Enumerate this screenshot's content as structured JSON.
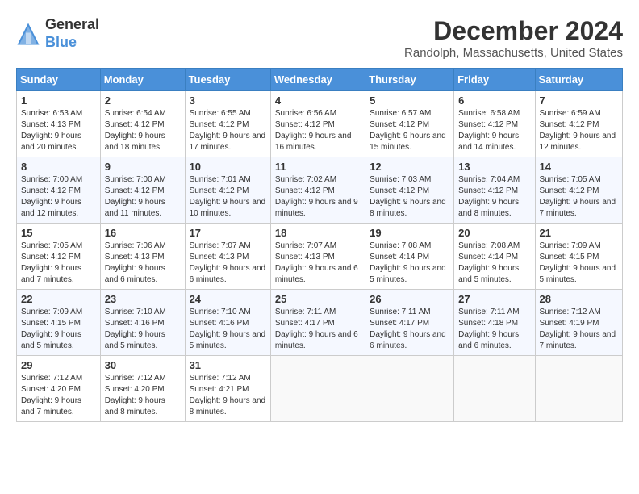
{
  "logo": {
    "line1": "General",
    "line2": "Blue"
  },
  "title": "December 2024",
  "subtitle": "Randolph, Massachusetts, United States",
  "days_header": [
    "Sunday",
    "Monday",
    "Tuesday",
    "Wednesday",
    "Thursday",
    "Friday",
    "Saturday"
  ],
  "weeks": [
    [
      {
        "day": "1",
        "sunrise": "6:53 AM",
        "sunset": "4:13 PM",
        "daylight": "9 hours and 20 minutes."
      },
      {
        "day": "2",
        "sunrise": "6:54 AM",
        "sunset": "4:12 PM",
        "daylight": "9 hours and 18 minutes."
      },
      {
        "day": "3",
        "sunrise": "6:55 AM",
        "sunset": "4:12 PM",
        "daylight": "9 hours and 17 minutes."
      },
      {
        "day": "4",
        "sunrise": "6:56 AM",
        "sunset": "4:12 PM",
        "daylight": "9 hours and 16 minutes."
      },
      {
        "day": "5",
        "sunrise": "6:57 AM",
        "sunset": "4:12 PM",
        "daylight": "9 hours and 15 minutes."
      },
      {
        "day": "6",
        "sunrise": "6:58 AM",
        "sunset": "4:12 PM",
        "daylight": "9 hours and 14 minutes."
      },
      {
        "day": "7",
        "sunrise": "6:59 AM",
        "sunset": "4:12 PM",
        "daylight": "9 hours and 12 minutes."
      }
    ],
    [
      {
        "day": "8",
        "sunrise": "7:00 AM",
        "sunset": "4:12 PM",
        "daylight": "9 hours and 12 minutes."
      },
      {
        "day": "9",
        "sunrise": "7:00 AM",
        "sunset": "4:12 PM",
        "daylight": "9 hours and 11 minutes."
      },
      {
        "day": "10",
        "sunrise": "7:01 AM",
        "sunset": "4:12 PM",
        "daylight": "9 hours and 10 minutes."
      },
      {
        "day": "11",
        "sunrise": "7:02 AM",
        "sunset": "4:12 PM",
        "daylight": "9 hours and 9 minutes."
      },
      {
        "day": "12",
        "sunrise": "7:03 AM",
        "sunset": "4:12 PM",
        "daylight": "9 hours and 8 minutes."
      },
      {
        "day": "13",
        "sunrise": "7:04 AM",
        "sunset": "4:12 PM",
        "daylight": "9 hours and 8 minutes."
      },
      {
        "day": "14",
        "sunrise": "7:05 AM",
        "sunset": "4:12 PM",
        "daylight": "9 hours and 7 minutes."
      }
    ],
    [
      {
        "day": "15",
        "sunrise": "7:05 AM",
        "sunset": "4:12 PM",
        "daylight": "9 hours and 7 minutes."
      },
      {
        "day": "16",
        "sunrise": "7:06 AM",
        "sunset": "4:13 PM",
        "daylight": "9 hours and 6 minutes."
      },
      {
        "day": "17",
        "sunrise": "7:07 AM",
        "sunset": "4:13 PM",
        "daylight": "9 hours and 6 minutes."
      },
      {
        "day": "18",
        "sunrise": "7:07 AM",
        "sunset": "4:13 PM",
        "daylight": "9 hours and 6 minutes."
      },
      {
        "day": "19",
        "sunrise": "7:08 AM",
        "sunset": "4:14 PM",
        "daylight": "9 hours and 5 minutes."
      },
      {
        "day": "20",
        "sunrise": "7:08 AM",
        "sunset": "4:14 PM",
        "daylight": "9 hours and 5 minutes."
      },
      {
        "day": "21",
        "sunrise": "7:09 AM",
        "sunset": "4:15 PM",
        "daylight": "9 hours and 5 minutes."
      }
    ],
    [
      {
        "day": "22",
        "sunrise": "7:09 AM",
        "sunset": "4:15 PM",
        "daylight": "9 hours and 5 minutes."
      },
      {
        "day": "23",
        "sunrise": "7:10 AM",
        "sunset": "4:16 PM",
        "daylight": "9 hours and 5 minutes."
      },
      {
        "day": "24",
        "sunrise": "7:10 AM",
        "sunset": "4:16 PM",
        "daylight": "9 hours and 5 minutes."
      },
      {
        "day": "25",
        "sunrise": "7:11 AM",
        "sunset": "4:17 PM",
        "daylight": "9 hours and 6 minutes."
      },
      {
        "day": "26",
        "sunrise": "7:11 AM",
        "sunset": "4:17 PM",
        "daylight": "9 hours and 6 minutes."
      },
      {
        "day": "27",
        "sunrise": "7:11 AM",
        "sunset": "4:18 PM",
        "daylight": "9 hours and 6 minutes."
      },
      {
        "day": "28",
        "sunrise": "7:12 AM",
        "sunset": "4:19 PM",
        "daylight": "9 hours and 7 minutes."
      }
    ],
    [
      {
        "day": "29",
        "sunrise": "7:12 AM",
        "sunset": "4:20 PM",
        "daylight": "9 hours and 7 minutes."
      },
      {
        "day": "30",
        "sunrise": "7:12 AM",
        "sunset": "4:20 PM",
        "daylight": "9 hours and 8 minutes."
      },
      {
        "day": "31",
        "sunrise": "7:12 AM",
        "sunset": "4:21 PM",
        "daylight": "9 hours and 8 minutes."
      },
      null,
      null,
      null,
      null
    ]
  ],
  "labels": {
    "sunrise": "Sunrise:",
    "sunset": "Sunset:",
    "daylight": "Daylight:"
  }
}
